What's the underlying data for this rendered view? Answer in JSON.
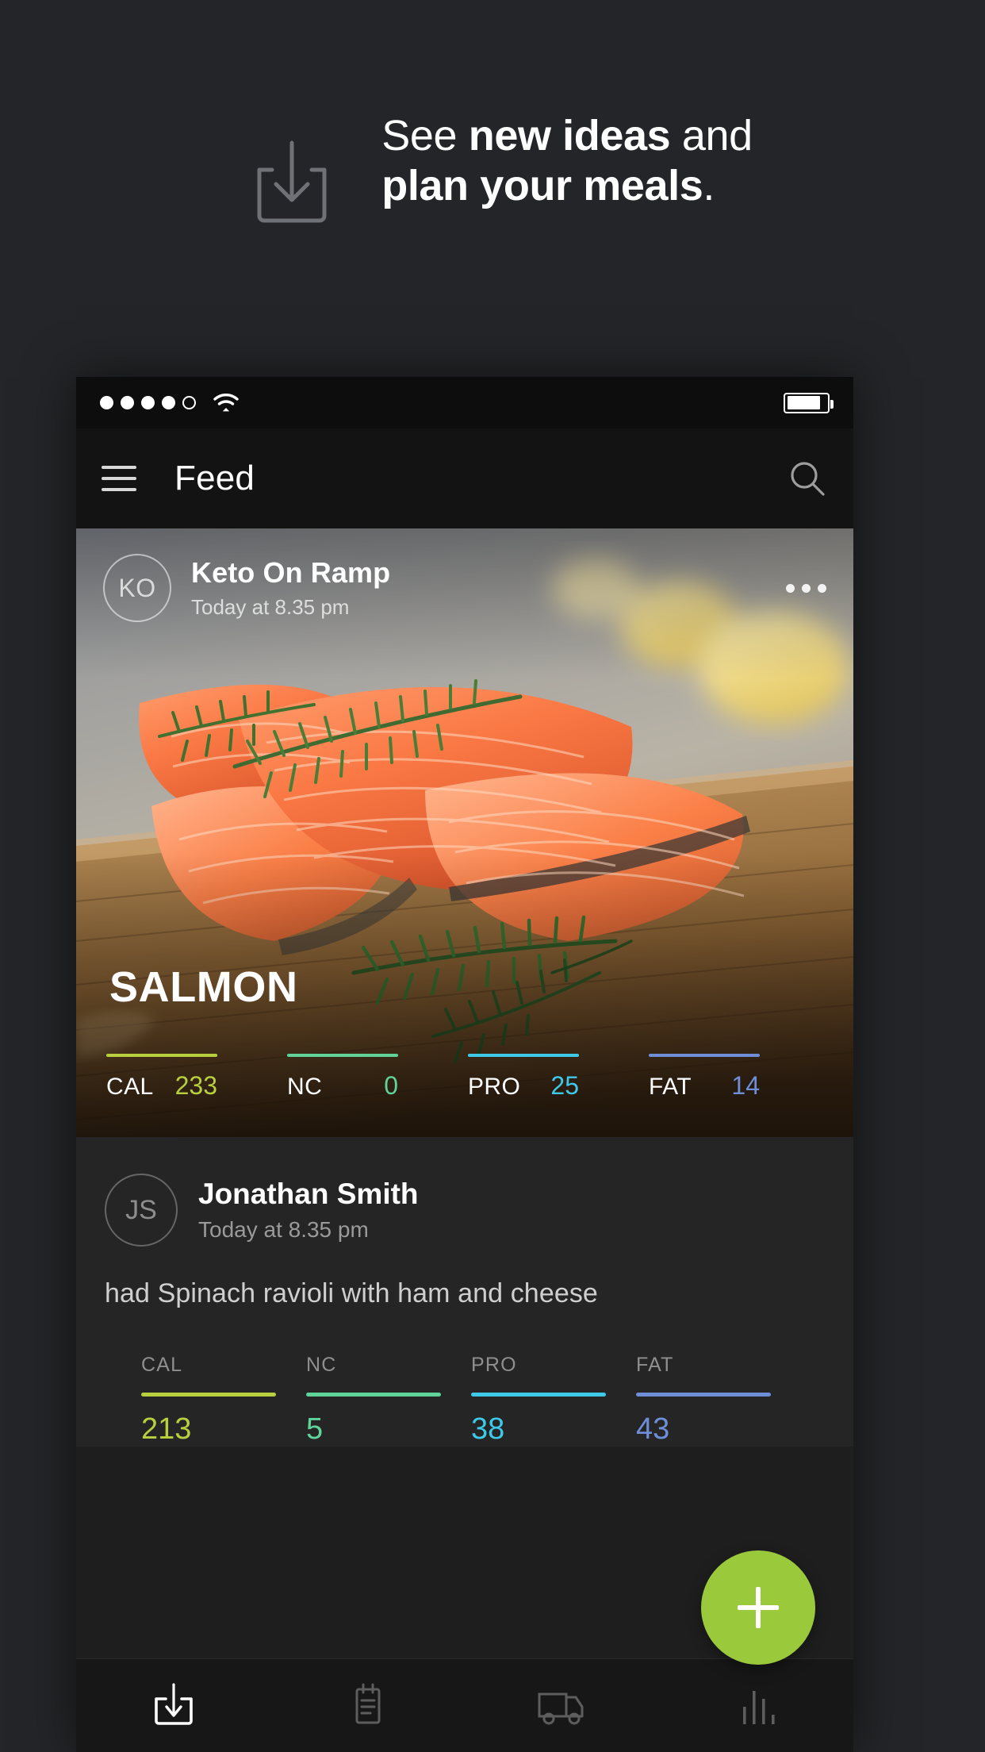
{
  "promo": {
    "icon": "inbox-download-icon",
    "headline_line1_plain_a": "See ",
    "headline_line1_bold": "new ideas",
    "headline_line1_plain_b": " and",
    "headline_line2_bold": "plan your meals",
    "headline_line2_plain": "."
  },
  "status_bar": {
    "signal_filled": 4,
    "signal_total": 5,
    "wifi_icon": "wifi-icon",
    "battery_icon": "battery-icon",
    "battery_level_percent": 85
  },
  "app_bar": {
    "menu_icon": "hamburger-menu-icon",
    "title": "Feed",
    "search_icon": "search-icon"
  },
  "feed": {
    "photo_post": {
      "avatar_initials": "KO",
      "author": "Keto On Ramp",
      "timestamp": "Today at 8.35 pm",
      "more_icon": "more-options-icon",
      "recipe_title": "SALMON",
      "macros": [
        {
          "label": "CAL",
          "value": "233",
          "color": "#b8cf3e"
        },
        {
          "label": "NC",
          "value": "0",
          "color": "#5fd39a"
        },
        {
          "label": "PRO",
          "value": "25",
          "color": "#3fc9e8"
        },
        {
          "label": "FAT",
          "value": "14",
          "color": "#6e8fd8"
        }
      ]
    },
    "text_post": {
      "avatar_initials": "JS",
      "author": "Jonathan Smith",
      "timestamp": "Today at 8.35 pm",
      "body": "had Spinach ravioli with ham and cheese",
      "macros": [
        {
          "label": "CAL",
          "value": "213",
          "color": "#b8cf3e"
        },
        {
          "label": "NC",
          "value": "5",
          "color": "#5fd39a"
        },
        {
          "label": "PRO",
          "value": "38",
          "color": "#3fc9e8"
        },
        {
          "label": "FAT",
          "value": "43",
          "color": "#6e8fd8"
        }
      ]
    }
  },
  "fab": {
    "icon": "plus-icon",
    "color": "#9ac93b"
  },
  "bottom_nav": {
    "items": [
      {
        "icon": "inbox-download-icon",
        "active": true
      },
      {
        "icon": "notepad-list-icon",
        "active": false
      },
      {
        "icon": "delivery-truck-icon",
        "active": false
      },
      {
        "icon": "bar-chart-icon",
        "active": false
      }
    ]
  }
}
